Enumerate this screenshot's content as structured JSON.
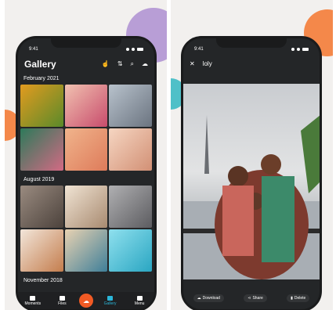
{
  "left": {
    "status_time": "9:41",
    "title": "Gallery",
    "sections": [
      {
        "title": "February 2021",
        "photos": [
          "#e29b1f",
          "#c84c6c",
          "#8c98a8",
          "#4fa36a",
          "#de7b5a",
          "#d29075"
        ]
      },
      {
        "title": "August 2019",
        "photos": [
          "#7d6e63",
          "#c3ad9b",
          "#8c8c8f",
          "#c47d4d",
          "#6aa0b2",
          "#5fc0d4"
        ]
      },
      {
        "title": "November 2018",
        "photos": []
      }
    ],
    "nav": [
      {
        "label": "Moments"
      },
      {
        "label": "Files"
      },
      {
        "label": ""
      },
      {
        "label": "Gallery"
      },
      {
        "label": "Menu"
      }
    ]
  },
  "right": {
    "status_time": "9:41",
    "album_title": "loly",
    "actions": {
      "download": "Download",
      "share": "Share",
      "delete": "Delete"
    }
  },
  "colors": {
    "accent": "#2bb6d9",
    "fab": "#f15a24",
    "phone_bg": "#242628",
    "blob_purple": "#b89ed6",
    "blob_orange": "#f4884a",
    "blob_teal": "#4fc0c8"
  }
}
